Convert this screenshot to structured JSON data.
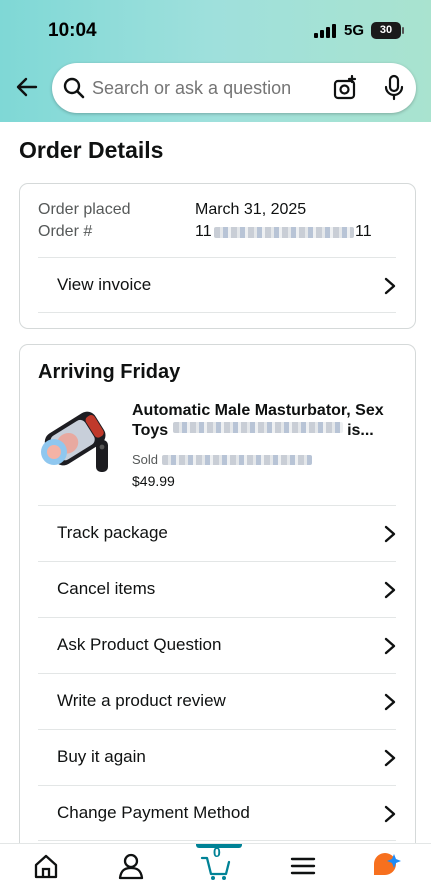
{
  "status_bar": {
    "time": "10:04",
    "network": "5G",
    "battery": "30"
  },
  "search": {
    "placeholder": "Search or ask a question"
  },
  "page": {
    "title": "Order Details"
  },
  "order": {
    "placed_label": "Order placed",
    "placed_value": "March 31, 2025",
    "number_label": "Order #",
    "number_prefix": "11",
    "number_suffix": "11",
    "invoice_label": "View invoice"
  },
  "shipment": {
    "heading": "Arriving Friday",
    "product": {
      "title_line1": "Automatic Male Masturbator, Sex",
      "title_line2_start": "Toys",
      "title_line2_end": "is...",
      "sold_by": "Sold",
      "price": "$49.99"
    },
    "actions": [
      {
        "label": "Track package"
      },
      {
        "label": "Cancel items"
      },
      {
        "label": "Ask Product Question"
      },
      {
        "label": "Write a product review"
      },
      {
        "label": "Buy it again"
      },
      {
        "label": "Change Payment Method"
      }
    ]
  },
  "bottom_nav": {
    "items": [
      {
        "icon": "home-icon"
      },
      {
        "icon": "account-icon"
      },
      {
        "icon": "cart-icon",
        "count": "0"
      },
      {
        "icon": "menu-icon"
      },
      {
        "icon": "rufus-assistant-icon"
      }
    ]
  },
  "colors": {
    "accent": "#008296",
    "header_gradient_start": "#7fd8d6",
    "header_gradient_end": "#a9e3cf",
    "assistant_orange": "#f7701e",
    "assistant_blue": "#1d8cf8"
  }
}
